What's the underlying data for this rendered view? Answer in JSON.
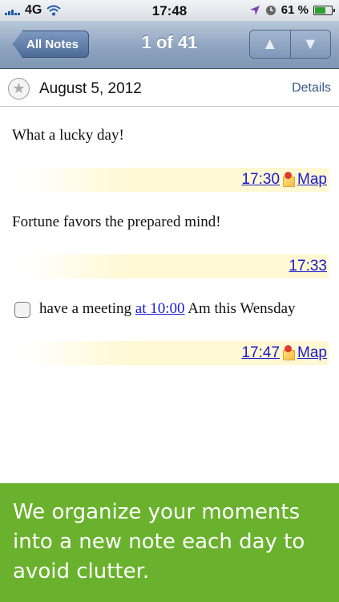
{
  "status_bar": {
    "carrier": "4G",
    "time": "17:48",
    "battery": "61 %",
    "battery_level": 0.61,
    "icons": [
      "signal-icon",
      "wifi-icon",
      "location-icon",
      "clock-icon",
      "battery-icon"
    ]
  },
  "nav": {
    "back_label": "All Notes",
    "title": "1 of 41",
    "prev_icon": "▲",
    "next_icon": "▼"
  },
  "header": {
    "date": "August 5, 2012",
    "details_label": "Details",
    "star_icon": "★"
  },
  "notes": [
    {
      "text": "What a lucky day!",
      "time": "17:30",
      "map_label": "Map"
    },
    {
      "text": "Fortune favors the prepared mind!",
      "time": "17:33"
    },
    {
      "text_before": "have a meeting ",
      "link": "at 10:00",
      "text_after": " Am this Wensday",
      "time": "17:47",
      "map_label": "Map"
    }
  ],
  "promo": {
    "text": "We organize your moments into a new note each day to avoid clutter."
  },
  "colors": {
    "promo_bg": "#6ab22d",
    "link": "#1a1ad0",
    "nav_bg": "#8ea4bf"
  }
}
